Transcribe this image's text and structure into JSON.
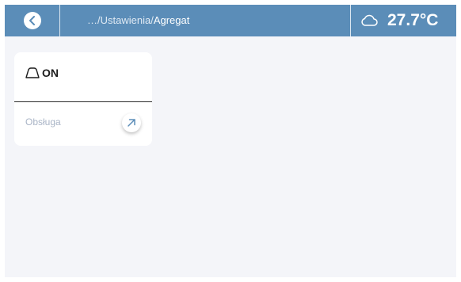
{
  "header": {
    "back_icon": "chevron-left-icon",
    "breadcrumb_path": "…/Ustawienia/",
    "breadcrumb_current": "Agregat",
    "weather_icon": "cloud-icon",
    "temperature": "27.7°C"
  },
  "card": {
    "status_icon": "generator-outline-icon",
    "status": "ON",
    "service_label": "Obsługa",
    "open_icon": "arrow-up-right-icon"
  },
  "colors": {
    "header_background": "#5b8db8",
    "page_background": "#f4f5f9",
    "card_background": "#ffffff",
    "muted_text": "#a9b4c6"
  }
}
